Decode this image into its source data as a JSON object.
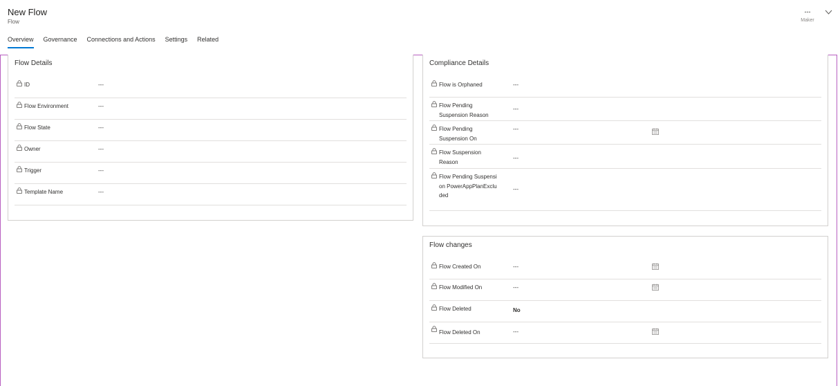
{
  "header": {
    "title": "New Flow",
    "subtitle": "Flow",
    "owner_value": "---",
    "owner_label": "Maker"
  },
  "tabs": [
    {
      "label": "Overview",
      "active": true
    },
    {
      "label": "Governance"
    },
    {
      "label": "Connections and Actions"
    },
    {
      "label": "Settings"
    },
    {
      "label": "Related"
    }
  ],
  "flow_details": {
    "title": "Flow Details",
    "rows": [
      {
        "label": "ID",
        "value": "---"
      },
      {
        "label": "Flow Environment",
        "value": "---"
      },
      {
        "label": "Flow State",
        "value": "---"
      },
      {
        "label": "Owner",
        "value": "---"
      },
      {
        "label": "Trigger",
        "value": "---"
      },
      {
        "label": "Template Name",
        "value": "---"
      }
    ]
  },
  "compliance_details": {
    "title": "Compliance Details",
    "rows": [
      {
        "label": "Flow is Orphaned",
        "value": "---"
      },
      {
        "label": "Flow Pending Suspension Reason",
        "value": "---"
      },
      {
        "label": "Flow Pending Suspension On",
        "value": "---"
      },
      {
        "label": "Flow Suspension Reason",
        "value": "---"
      },
      {
        "label": "Flow Pending Suspension PowerAppPlanExcluded",
        "value": "---"
      }
    ]
  },
  "flow_changes": {
    "title": "Flow changes",
    "rows": [
      {
        "label": "Flow Created On",
        "value": "---"
      },
      {
        "label": "Flow Modified On",
        "value": "---"
      },
      {
        "label": "Flow Deleted",
        "value": "No"
      },
      {
        "label": "Flow Deleted On",
        "value": "---"
      }
    ]
  },
  "icons": {
    "lock": "lock-icon",
    "calendar": "calendar-icon",
    "chevron": "chevron-down-icon"
  },
  "colors": {
    "accent": "#0078d4",
    "frame": "#b75ec0",
    "border": "#d2d0ce"
  }
}
